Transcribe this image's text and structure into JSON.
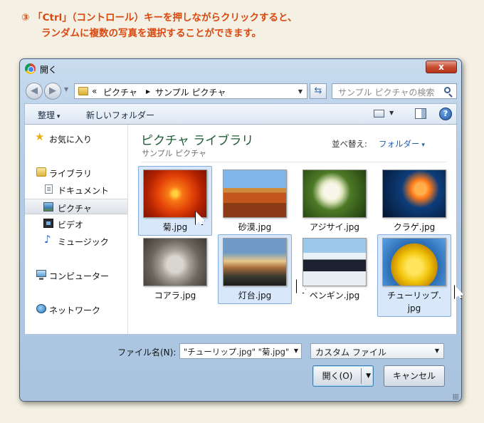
{
  "instruction": {
    "line1": "③ 「Ctrl」（コントロール）キーを押しながらクリックすると、",
    "line2": "ランダムに複数の写真を選択することができます。"
  },
  "window": {
    "title": "開く",
    "close_label": "x"
  },
  "address": {
    "prefix": "«",
    "crumbs": [
      "ピクチャ",
      "サンプル ピクチャ"
    ]
  },
  "search": {
    "placeholder": "サンプル ピクチャの検索"
  },
  "toolbar": {
    "organize": "整理",
    "new_folder": "新しいフォルダー",
    "help": "?"
  },
  "sidebar": {
    "items": [
      {
        "label": "お気に入り",
        "icon": "star-icon"
      },
      {
        "label": "ライブラリ",
        "icon": "library-icon"
      },
      {
        "label": "ドキュメント",
        "icon": "document-icon"
      },
      {
        "label": "ピクチャ",
        "icon": "picture-icon",
        "selected": true
      },
      {
        "label": "ビデオ",
        "icon": "video-icon"
      },
      {
        "label": "ミュージック",
        "icon": "music-icon"
      },
      {
        "label": "コンピューター",
        "icon": "computer-icon"
      },
      {
        "label": "ネットワーク",
        "icon": "network-icon"
      }
    ]
  },
  "content": {
    "title": "ピクチャ ライブラリ",
    "subtitle": "サンプル ピクチャ",
    "arrange_label": "並べ替え:",
    "arrange_value": "フォルダー",
    "files": [
      {
        "name": "菊.jpg",
        "selected": true
      },
      {
        "name": "砂漠.jpg",
        "selected": false
      },
      {
        "name": "アジサイ.jpg",
        "selected": false
      },
      {
        "name": "クラゲ.jpg",
        "selected": false
      },
      {
        "name": "コアラ.jpg",
        "selected": false
      },
      {
        "name": "灯台.jpg",
        "selected": true
      },
      {
        "name": "ペンギン.jpg",
        "selected": false
      },
      {
        "name": "チューリップ.jpg",
        "name_line1": "チューリップ.",
        "name_line2": "jpg",
        "selected": true
      }
    ]
  },
  "footer": {
    "filename_label": "ファイル名(N):",
    "filename_value": "\"チューリップ.jpg\" \"菊.jpg\"",
    "filter_value": "カスタム ファイル",
    "open_label": "開く(O)",
    "cancel_label": "キャンセル"
  },
  "colors": {
    "instruction": "#d9480f",
    "selection": "#d8e8fa",
    "library_title": "#1e5b34",
    "link": "#1f5fae"
  }
}
